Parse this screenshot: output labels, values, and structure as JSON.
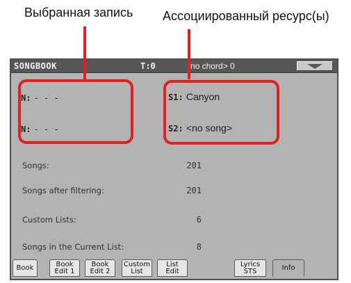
{
  "annotations": {
    "selected_entry": "Выбранная запись",
    "associated_resources": "Ассоциированный ресурс(ы)",
    "highlight_color": "#e1201f"
  },
  "titlebar": {
    "title": "SONGBOOK",
    "tempo": "T:0",
    "chord": "no chord> 0",
    "menu_icon": "triangle-down-icon"
  },
  "entries": {
    "n1": {
      "label": "N:",
      "value": "- - -"
    },
    "n2": {
      "label": "N:",
      "value": "- - -"
    }
  },
  "resources": {
    "s1": {
      "label": "S1:",
      "value": "Canyon"
    },
    "s2": {
      "label": "S2:",
      "value": "<no song>"
    }
  },
  "stats": [
    {
      "label": "Songs:",
      "value": "201"
    },
    {
      "label": "Songs after filtering:",
      "value": "201"
    },
    {
      "label": "Custom Lists:",
      "value": "6"
    },
    {
      "label": "Songs in the Current List:",
      "value": "8"
    }
  ],
  "tabs": [
    {
      "label": "Book"
    },
    {
      "label": "Book\nEdit 1"
    },
    {
      "label": "Book\nEdit 2"
    },
    {
      "label": "Custom\nList"
    },
    {
      "label": "List\nEdit"
    },
    {
      "label": "Lyrics\nSTS"
    },
    {
      "label": "Info",
      "active": true
    }
  ]
}
